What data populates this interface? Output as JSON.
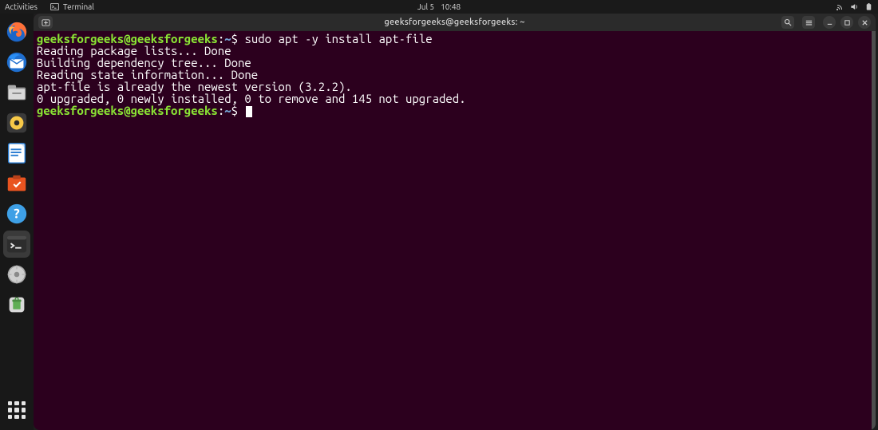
{
  "topbar": {
    "activities": "Activities",
    "app_label": "Terminal",
    "date": "Jul 5",
    "time": "10:48"
  },
  "dock": {
    "items": [
      {
        "name": "firefox-icon"
      },
      {
        "name": "thunderbird-icon"
      },
      {
        "name": "files-icon"
      },
      {
        "name": "rhythmbox-icon"
      },
      {
        "name": "libreoffice-writer-icon"
      },
      {
        "name": "ubuntu-software-icon"
      },
      {
        "name": "help-icon"
      },
      {
        "name": "terminal-icon",
        "active": true
      },
      {
        "name": "disk-icon"
      },
      {
        "name": "trash-icon"
      }
    ],
    "apps_label": "show-applications"
  },
  "terminal": {
    "title": "geeksforgeeks@geeksforgeeks: ~",
    "prompt": {
      "user": "geeksforgeeks@geeksforgeeks",
      "colon": ":",
      "cwd": "~",
      "sym": "$ "
    },
    "cmd1": "sudo apt -y install apt-file",
    "out1": "Reading package lists... Done",
    "out2": "Building dependency tree... Done",
    "out3": "Reading state information... Done",
    "out4": "apt-file is already the newest version (3.2.2).",
    "out5": "0 upgraded, 0 newly installed, 0 to remove and 145 not upgraded."
  }
}
